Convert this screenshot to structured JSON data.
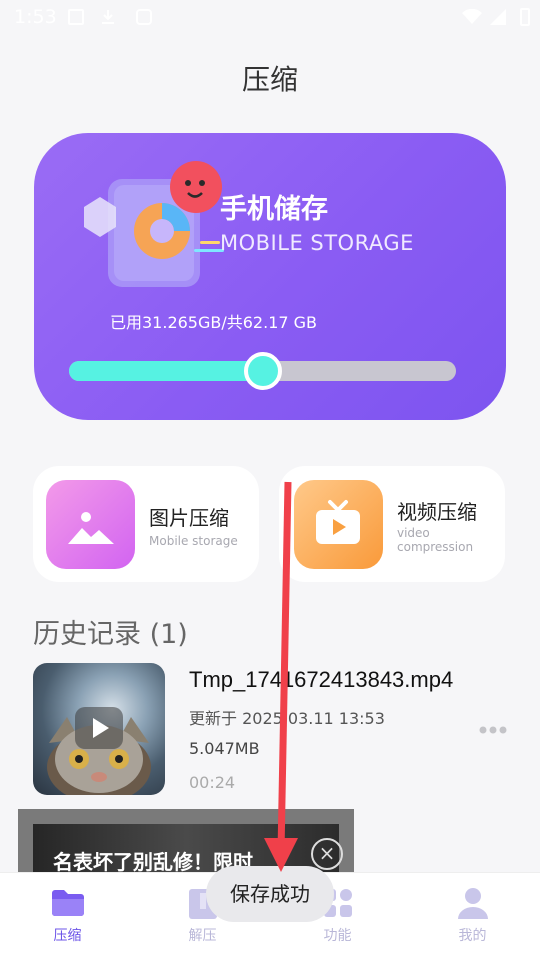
{
  "status_bar": {
    "time": "1:53"
  },
  "header": {
    "title": "压缩"
  },
  "storage": {
    "title": "手机储存",
    "subtitle": "MOBILE STORAGE",
    "usage": "已用31.265GB/共62.17 GB",
    "used_fraction": 0.5
  },
  "features": [
    {
      "title": "图片压缩",
      "subtitle": "Mobile storage"
    },
    {
      "title": "视频压缩",
      "subtitle": "video compression"
    }
  ],
  "history": {
    "title": "历史记录 (1)",
    "items": [
      {
        "name": "Tmp_1741672413843.mp4",
        "date": "更新于 2025.03.11 13:53",
        "size": "5.047MB",
        "duration": "00:24"
      }
    ]
  },
  "ad": {
    "text": "名表坏了别乱修！限时",
    "close": "×"
  },
  "toast": {
    "text": "保存成功"
  },
  "nav": {
    "items": [
      {
        "label": "压缩"
      },
      {
        "label": "解压"
      },
      {
        "label": "功能"
      },
      {
        "label": "我的"
      }
    ]
  },
  "colors": {
    "accent": "#6d55e8",
    "card_purple": "#8a5cf3",
    "progress": "#56f2e2",
    "annotation_arrow": "#f0404a"
  }
}
